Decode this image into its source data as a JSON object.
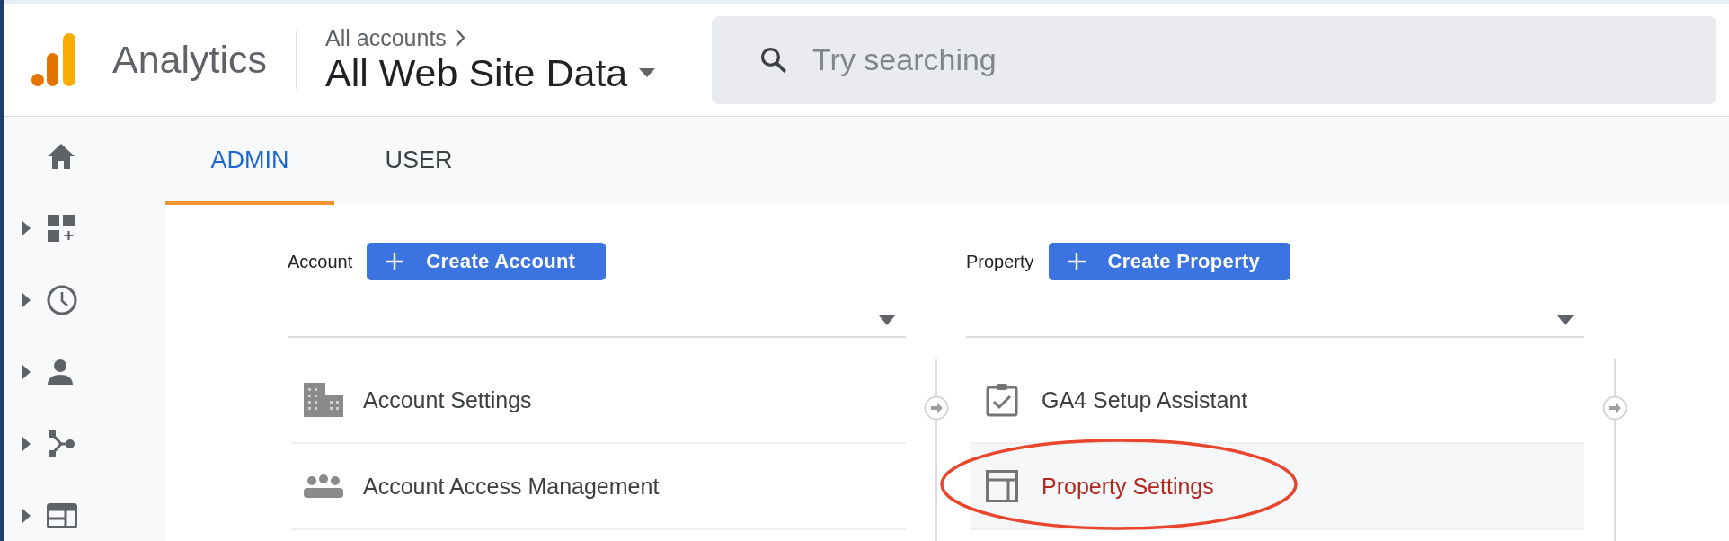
{
  "header": {
    "product": "Analytics",
    "breadcrumb": "All accounts",
    "view": "All Web Site Data"
  },
  "search": {
    "placeholder": "Try searching"
  },
  "sidebar": {
    "items": [
      {
        "expandable": false
      },
      {
        "expandable": true
      },
      {
        "expandable": true
      },
      {
        "expandable": true
      },
      {
        "expandable": true
      },
      {
        "expandable": true
      }
    ]
  },
  "tabs": [
    {
      "label": "ADMIN",
      "selected": true
    },
    {
      "label": "USER",
      "selected": false
    }
  ],
  "columns": [
    {
      "label": "Account",
      "button": "Create Account",
      "items": [
        {
          "label": "Account Settings",
          "selected": false,
          "circled": false
        },
        {
          "label": "Account Access Management",
          "selected": false,
          "circled": false
        }
      ]
    },
    {
      "label": "Property",
      "button": "Create Property",
      "items": [
        {
          "label": "GA4 Setup Assistant",
          "selected": false,
          "circled": false
        },
        {
          "label": "Property Settings",
          "selected": true,
          "circled": true
        }
      ]
    }
  ]
}
